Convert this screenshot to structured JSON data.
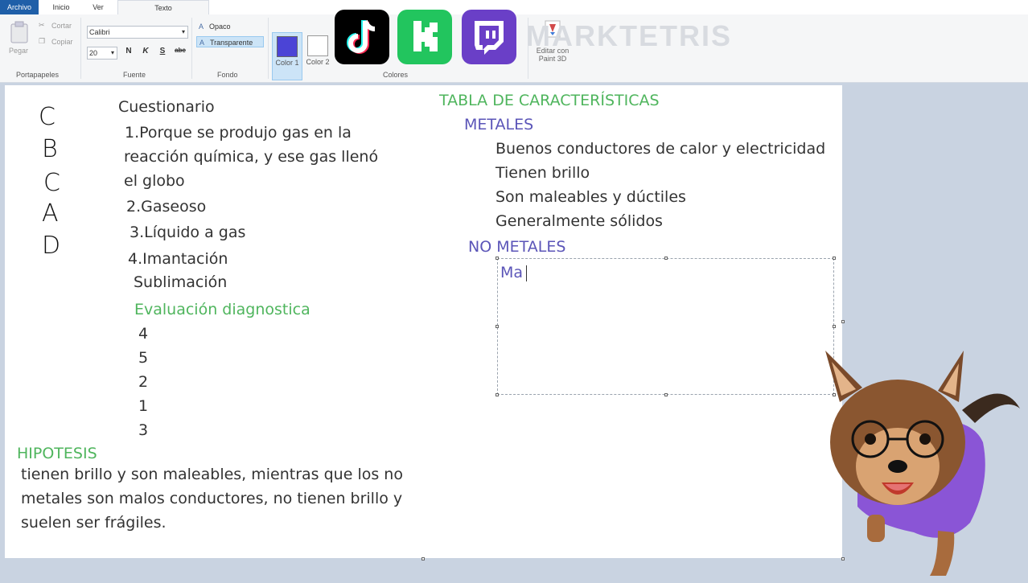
{
  "tabs": [
    {
      "label": "Archivo"
    },
    {
      "label": "Inicio"
    },
    {
      "label": "Ver"
    },
    {
      "label": "Texto"
    }
  ],
  "ribbon": {
    "clipboard": {
      "paste": "Pegar",
      "cut": "Cortar",
      "copy": "Copiar",
      "group": "Portapapeles"
    },
    "font": {
      "family": "Calibri",
      "size": "20",
      "bold": "N",
      "italic": "K",
      "underline": "S",
      "strike": "abc",
      "group": "Fuente"
    },
    "background": {
      "opaque": "Opaco",
      "transparent": "Transparente",
      "group": "Fondo"
    },
    "colors": {
      "color1": "Color 1",
      "color2": "Color 2",
      "group": "Colores",
      "color1_value": "#4b44d6",
      "color2_value": "#ffffff"
    },
    "paint3d": "Editar con Paint 3D",
    "watermark": "MARKTETRIS"
  },
  "overlay_logos": [
    "tiktok-logo",
    "kick-logo",
    "twitch-logo"
  ],
  "canvas": {
    "answers_letters": [
      "C",
      "B",
      "C",
      "A",
      "D"
    ],
    "questionnaire": {
      "title": "Cuestionario",
      "q1_line1": "1.Porque se produjo gas en la",
      "q1_line2": "reacción química, y ese gas llenó",
      "q1_line3": "el globo",
      "q2": "2.Gaseoso",
      "q3": "3.Líquido a gas",
      "q4": "4.Imantación",
      "q4b": "Sublimación"
    },
    "diagnostic": {
      "title": "Evaluación diagnostica",
      "values": [
        "4",
        "5",
        "2",
        "1",
        "3"
      ]
    },
    "hypothesis": {
      "title": "HIPOTESIS",
      "line1": "tienen brillo y son maleables, mientras que los no",
      "line2": "metales son malos conductores, no tienen brillo y",
      "line3": "suelen ser frágiles."
    },
    "table": {
      "title": "TABLA DE CARACTERÍSTICAS",
      "metals_title": "METALES",
      "metals_items": [
        "Buenos conductores de calor y electricidad",
        "Tienen brillo",
        "Son maleables y dúctiles",
        "Generalmente sólidos"
      ],
      "nonmetals_title": "NO METALES",
      "typing": "Ma"
    }
  },
  "colors": {
    "accent_green": "#4fb55d",
    "accent_blue": "#5b55b8",
    "file_tab": "#1f5fa8"
  }
}
